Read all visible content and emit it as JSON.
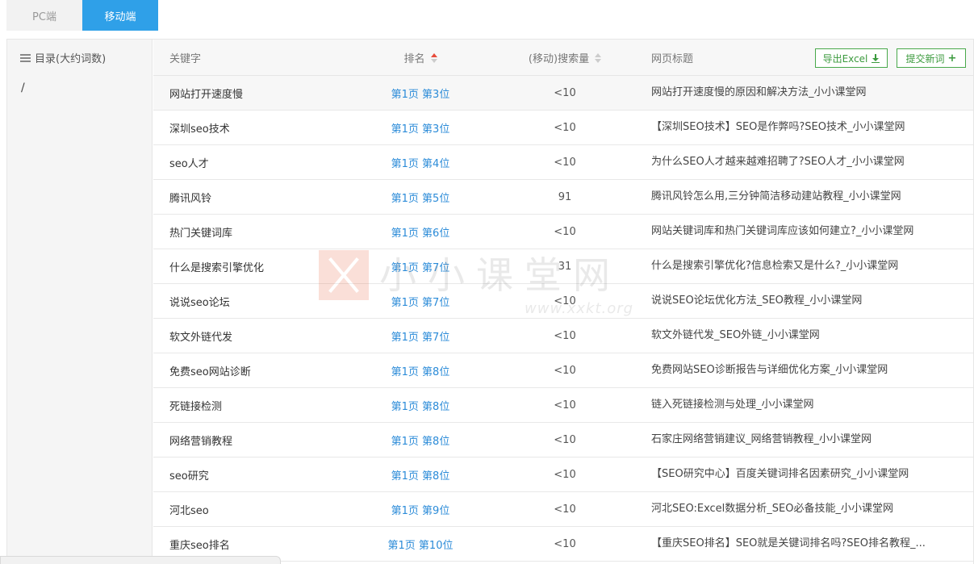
{
  "tabs": [
    {
      "label": "PC端",
      "active": false
    },
    {
      "label": "移动端",
      "active": true
    }
  ],
  "sidebar": {
    "title": "目录(大约词数)",
    "path": "/"
  },
  "table": {
    "headers": {
      "keyword": "关键字",
      "rank": "排名",
      "volume": "(移动)搜索量",
      "title": "网页标题"
    },
    "buttons": {
      "export": "导出Excel",
      "submit": "提交新词"
    },
    "rows": [
      {
        "keyword": "网站打开速度慢",
        "rank": "第1页 第3位",
        "volume": "<10",
        "title": "网站打开速度慢的原因和解决方法_小小课堂网"
      },
      {
        "keyword": "深圳seo技术",
        "rank": "第1页 第3位",
        "volume": "<10",
        "title": "【深圳SEO技术】SEO是作弊吗?SEO技术_小小课堂网"
      },
      {
        "keyword": "seo人才",
        "rank": "第1页 第4位",
        "volume": "<10",
        "title": "为什么SEO人才越来越难招聘了?SEO人才_小小课堂网"
      },
      {
        "keyword": "腾讯风铃",
        "rank": "第1页 第5位",
        "volume": "91",
        "title": "腾讯风铃怎么用,三分钟简洁移动建站教程_小小课堂网"
      },
      {
        "keyword": "热门关键词库",
        "rank": "第1页 第6位",
        "volume": "<10",
        "title": "网站关键词库和热门关键词库应该如何建立?_小小课堂网"
      },
      {
        "keyword": "什么是搜索引擎优化",
        "rank": "第1页 第7位",
        "volume": "31",
        "title": "什么是搜索引擎优化?信息检索又是什么?_小小课堂网"
      },
      {
        "keyword": "说说seo论坛",
        "rank": "第1页 第7位",
        "volume": "<10",
        "title": "说说SEO论坛优化方法_SEO教程_小小课堂网"
      },
      {
        "keyword": "软文外链代发",
        "rank": "第1页 第7位",
        "volume": "<10",
        "title": "软文外链代发_SEO外链_小小课堂网"
      },
      {
        "keyword": "免费seo网站诊断",
        "rank": "第1页 第8位",
        "volume": "<10",
        "title": "免费网站SEO诊断报告与详细优化方案_小小课堂网"
      },
      {
        "keyword": "死链接检测",
        "rank": "第1页 第8位",
        "volume": "<10",
        "title": "链入死链接检测与处理_小小课堂网"
      },
      {
        "keyword": "网络营销教程",
        "rank": "第1页 第8位",
        "volume": "<10",
        "title": "石家庄网络营销建议_网络营销教程_小小课堂网"
      },
      {
        "keyword": "seo研究",
        "rank": "第1页 第8位",
        "volume": "<10",
        "title": "【SEO研究中心】百度关键词排名因素研究_小小课堂网"
      },
      {
        "keyword": "河北seo",
        "rank": "第1页 第9位",
        "volume": "<10",
        "title": "河北SEO:Excel数据分析_SEO必备技能_小小课堂网"
      },
      {
        "keyword": "重庆seo排名",
        "rank": "第1页 第10位",
        "volume": "<10",
        "title": "【重庆SEO排名】SEO就是关键词排名吗?SEO排名教程_..."
      }
    ]
  },
  "watermark": {
    "text": "小小课堂网",
    "url": "www.xxkt.org"
  },
  "colors": {
    "accent": "#2fa0e8",
    "link": "#2b8bd8",
    "button": "#48a84a",
    "sort_active": "#e74c3c"
  }
}
